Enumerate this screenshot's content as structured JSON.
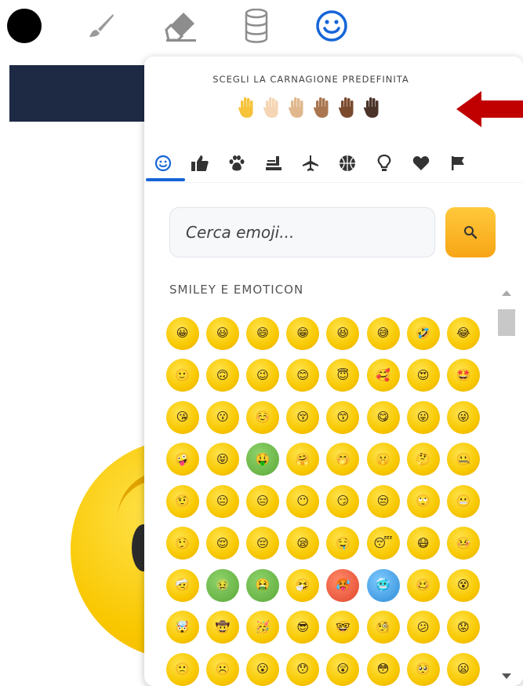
{
  "toolbar": {
    "tools": [
      "color-dot",
      "brush-icon",
      "eraser-icon",
      "database-icon",
      "emoji-icon"
    ],
    "active_color": "#000000",
    "accent": "#1665d8"
  },
  "panel": {
    "skin_title": "SCEGLI LA CARNAGIONE PREDEFINITA",
    "skin_tones": [
      "#F6C33B",
      "#F5D5B4",
      "#E1B88E",
      "#A97650",
      "#7A4A2D",
      "#4B3329"
    ],
    "categories": [
      "smiley-icon",
      "thumbs-up-icon",
      "paw-icon",
      "food-icon",
      "airplane-icon",
      "ball-icon",
      "lightbulb-icon",
      "heart-icon",
      "flag-icon"
    ],
    "search": {
      "placeholder": "Cerca emoji...",
      "button_icon": "search-icon"
    },
    "section_title": "SMILEY E EMOTICON",
    "emojis": [
      "😀",
      "😃",
      "😄",
      "😁",
      "😆",
      "😅",
      "🤣",
      "😂",
      "🙂",
      "🙃",
      "😉",
      "😊",
      "😇",
      "🥰",
      "😍",
      "🤩",
      "😘",
      "😗",
      "☺️",
      "😚",
      "😙",
      "😋",
      "😛",
      "😜",
      "🤪",
      "😝",
      "🤑",
      "🤗",
      "🤭",
      "🤫",
      "🤔",
      "🤐",
      "🤨",
      "😐",
      "😑",
      "😶",
      "😏",
      "😒",
      "🙄",
      "😬",
      "🤥",
      "😌",
      "😔",
      "😪",
      "🤤",
      "😴",
      "😷",
      "🤒",
      "🤕",
      "🤢",
      "🤮",
      "🤧",
      "🥵",
      "🥶",
      "🥴",
      "😵",
      "🤯",
      "🤠",
      "🥳",
      "😎",
      "🤓",
      "🧐",
      "😕",
      "😟",
      "🙁",
      "☹️",
      "😮",
      "😯",
      "😲",
      "😳",
      "🥺",
      "😦"
    ]
  },
  "annotation": {
    "arrow_color": "#C00000"
  }
}
